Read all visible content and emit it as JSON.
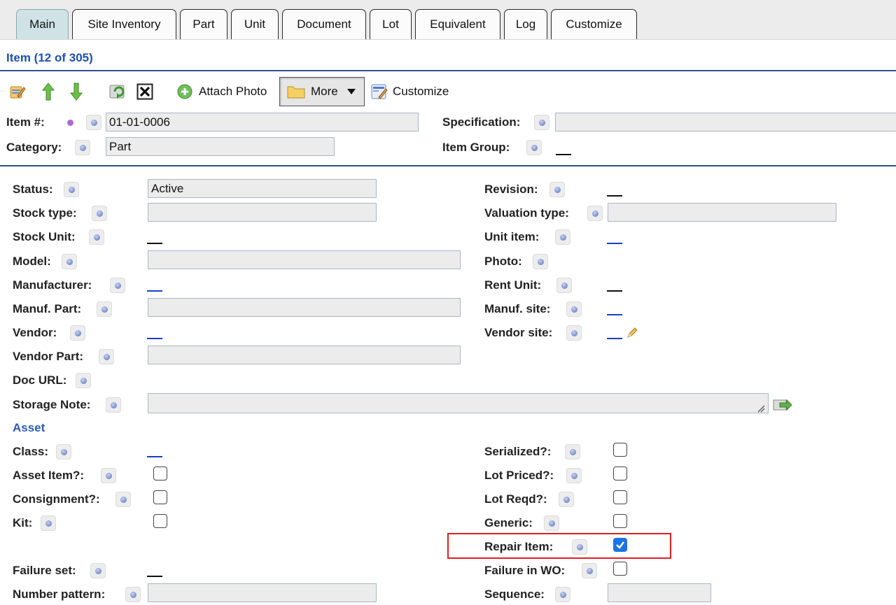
{
  "tabs": [
    {
      "label": "Main",
      "active": true
    },
    {
      "label": "Site Inventory"
    },
    {
      "label": "Part"
    },
    {
      "label": "Unit"
    },
    {
      "label": "Document"
    },
    {
      "label": "Lot"
    },
    {
      "label": "Equivalent"
    },
    {
      "label": "Log"
    },
    {
      "label": "Customize"
    }
  ],
  "header": {
    "title": "Item (12 of 305)"
  },
  "toolbar": {
    "attach_photo": "Attach Photo",
    "more": "More",
    "customize": "Customize",
    "icons": [
      "edit-icon",
      "move-up-icon",
      "move-down-icon",
      "refresh-icon",
      "delete-icon",
      "add-icon",
      "folder-icon",
      "dropdown-arrow-icon",
      "customize-icon"
    ]
  },
  "top_fields": {
    "item_label": "Item #:",
    "item_value": "01-01-0006",
    "specification_label": "Specification:",
    "specification_value": "",
    "category_label": "Category:",
    "category_value": "Part",
    "item_group_label": "Item Group:",
    "item_group_value": "__"
  },
  "fields": {
    "status": {
      "label": "Status:",
      "value": "Active"
    },
    "stock_type": {
      "label": "Stock type:",
      "value": ""
    },
    "stock_unit": {
      "label": "Stock Unit:",
      "value": "__"
    },
    "model": {
      "label": "Model:",
      "value": ""
    },
    "manufacturer": {
      "label": "Manufacturer:",
      "value": "__"
    },
    "manuf_part": {
      "label": "Manuf. Part:",
      "value": ""
    },
    "vendor": {
      "label": "Vendor:",
      "value": "__"
    },
    "vendor_part": {
      "label": "Vendor Part:",
      "value": ""
    },
    "doc_url": {
      "label": "Doc URL:"
    },
    "storage_note": {
      "label": "Storage Note:",
      "value": ""
    },
    "revision": {
      "label": "Revision:",
      "value": "__"
    },
    "valuation_type": {
      "label": "Valuation type:",
      "value": ""
    },
    "unit_item": {
      "label": "Unit item:",
      "value": "__"
    },
    "photo": {
      "label": "Photo:"
    },
    "rent_unit": {
      "label": "Rent Unit:",
      "value": "__"
    },
    "manuf_site": {
      "label": "Manuf. site:",
      "value": "__"
    },
    "vendor_site": {
      "label": "Vendor site:",
      "value": "__"
    }
  },
  "asset": {
    "section_label": "Asset",
    "class": {
      "label": "Class:",
      "value": "__"
    },
    "asset_item": {
      "label": "Asset Item?:",
      "checked": false
    },
    "consignment": {
      "label": "Consignment?:",
      "checked": false
    },
    "kit": {
      "label": "Kit:",
      "checked": false
    },
    "failure_set": {
      "label": "Failure set:",
      "value": "__"
    },
    "number_pattern": {
      "label": "Number pattern:",
      "value": ""
    },
    "serialized": {
      "label": "Serialized?:",
      "checked": false
    },
    "lot_priced": {
      "label": "Lot Priced?:",
      "checked": false
    },
    "lot_reqd": {
      "label": "Lot Reqd?:",
      "checked": false
    },
    "generic": {
      "label": "Generic:",
      "checked": false
    },
    "repair_item": {
      "label": "Repair Item:",
      "checked": true
    },
    "failure_in_wo": {
      "label": "Failure in WO:",
      "checked": false
    },
    "sequence": {
      "label": "Sequence:",
      "value": ""
    }
  },
  "colors": {
    "tab_active": "#cfe3e7",
    "section_blue": "#2c5bb8",
    "highlight": "#e02020",
    "checkbox_checked": "#1a73e8"
  }
}
